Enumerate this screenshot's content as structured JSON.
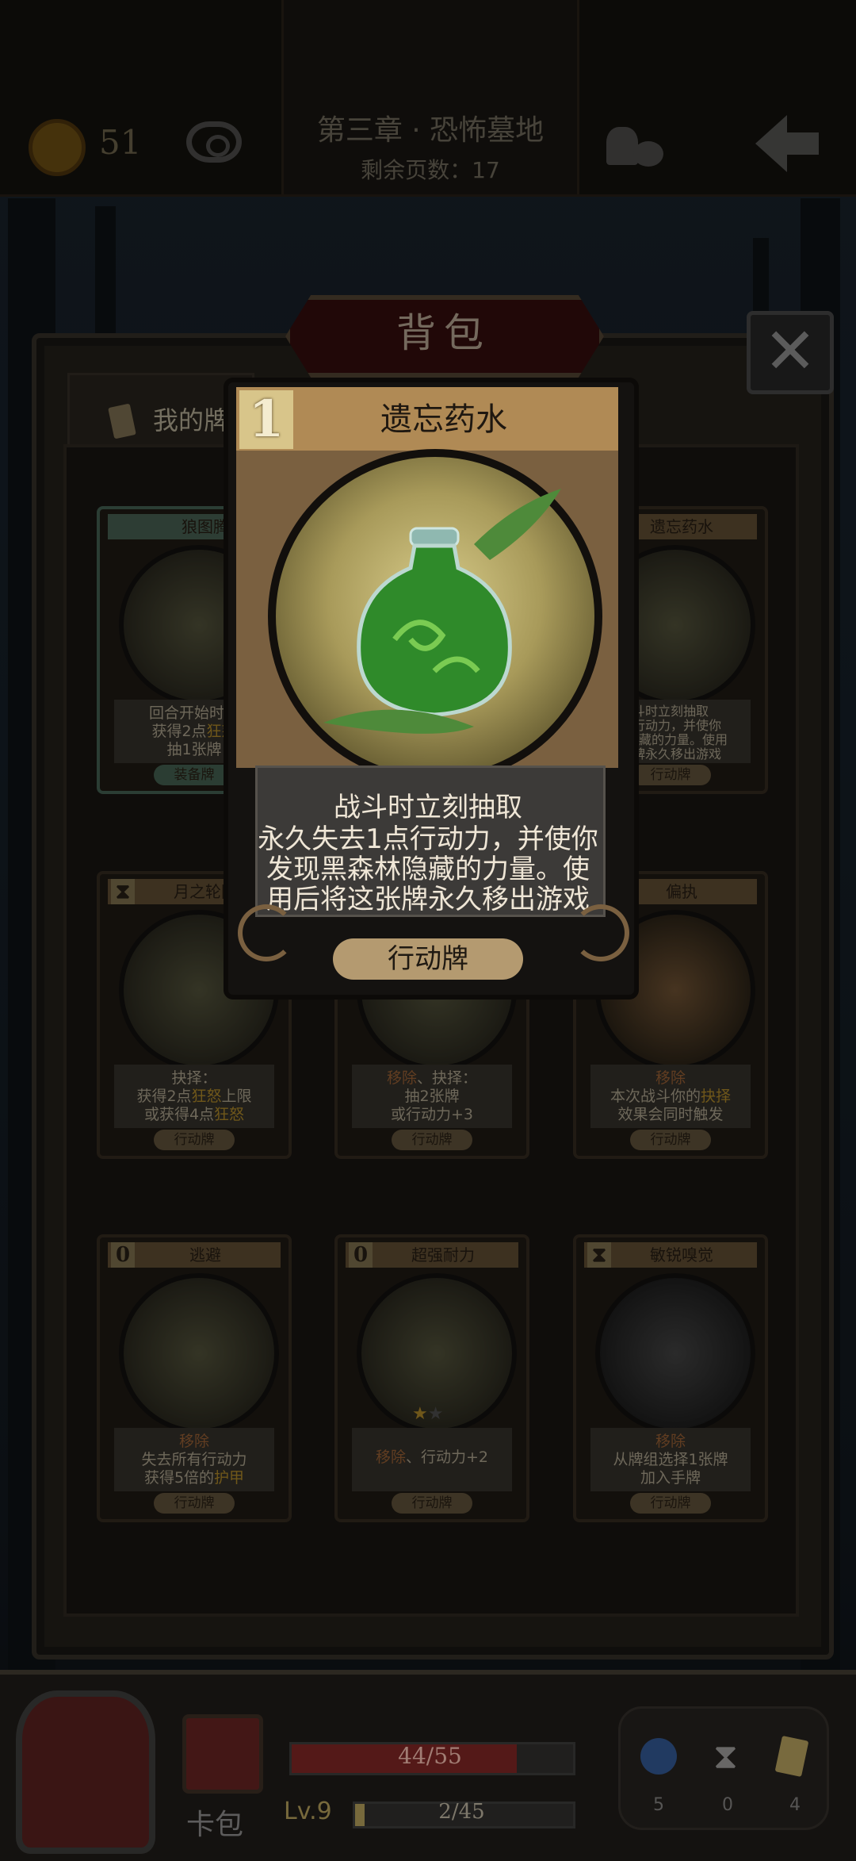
{
  "top_bar": {
    "coins": "51",
    "chapter": "第三章 · 恐怖墓地",
    "pages_remaining": "剩余页数：17"
  },
  "backpack": {
    "title": "背包",
    "tab_label": "我的牌",
    "close_symbol": "✕"
  },
  "detail_card": {
    "cost": "1",
    "name": "遗忘药水",
    "desc_lines": [
      "战斗时立刻抽取",
      "永久失去1点行动力，并使你",
      "发现黑森林隐藏的力量。使",
      "用后将这张牌永久移出游戏"
    ],
    "type": "行动牌"
  },
  "cards": [
    {
      "name": "狼图腾",
      "cost": "",
      "desc1": "回合开始时移",
      "desc2a": "获得2点",
      "desc2b": "狂怒",
      "desc3": "抽1张牌",
      "type": "装备牌"
    },
    {
      "name": "遗忘药水",
      "cost": "",
      "desc1": "斗时立刻抽取",
      "desc2": "点行动力，并使你",
      "desc3": "林隐藏的力量。使用",
      "desc4": "张牌永久移出游戏",
      "type": "行动牌"
    },
    {
      "name": "月之轮回",
      "cost": "",
      "desc1": "抉择：",
      "desc2a": "获得2点",
      "desc2b": "狂怒",
      "desc2c": "上限",
      "desc3a": "或获得4点",
      "desc3b": "狂怒",
      "type": "行动牌"
    },
    {
      "name": "",
      "cost": "",
      "desc1a": "移除",
      "desc1b": "、抉择：",
      "desc2": "抽2张牌",
      "desc3": "或行动力+3",
      "type": "行动牌"
    },
    {
      "name": "偏执",
      "cost": "",
      "desc1": "移除",
      "desc2a": "本次战斗你的",
      "desc2b": "抉择",
      "desc3": "效果会同时触发",
      "type": "行动牌"
    },
    {
      "name": "逃避",
      "cost": "0",
      "desc1": "移除",
      "desc2": "失去所有行动力",
      "desc3a": "获得5倍的",
      "desc3b": "护甲",
      "type": "行动牌"
    },
    {
      "name": "超强耐力",
      "cost": "0",
      "desc1a": "移除",
      "desc1b": "、行动力+2",
      "type": "行动牌"
    },
    {
      "name": "敏锐嗅觉",
      "cost": "",
      "desc1": "移除",
      "desc2": "从牌组选择1张牌",
      "desc3": "加入手牌",
      "type": "行动牌"
    }
  ],
  "bottom_bar": {
    "hp": "44/55",
    "hp_fraction": 0.8,
    "level": "Lv.9",
    "xp": "2/45",
    "xp_fraction": 0.044,
    "deck_label": "卡包",
    "counter_potion": "5",
    "counter_hourglass": "0",
    "counter_cards": "4"
  },
  "colors": {
    "highlight": "#c0962e",
    "hp_bar": "#8a1f1f",
    "banner": "#3a0e0e"
  }
}
